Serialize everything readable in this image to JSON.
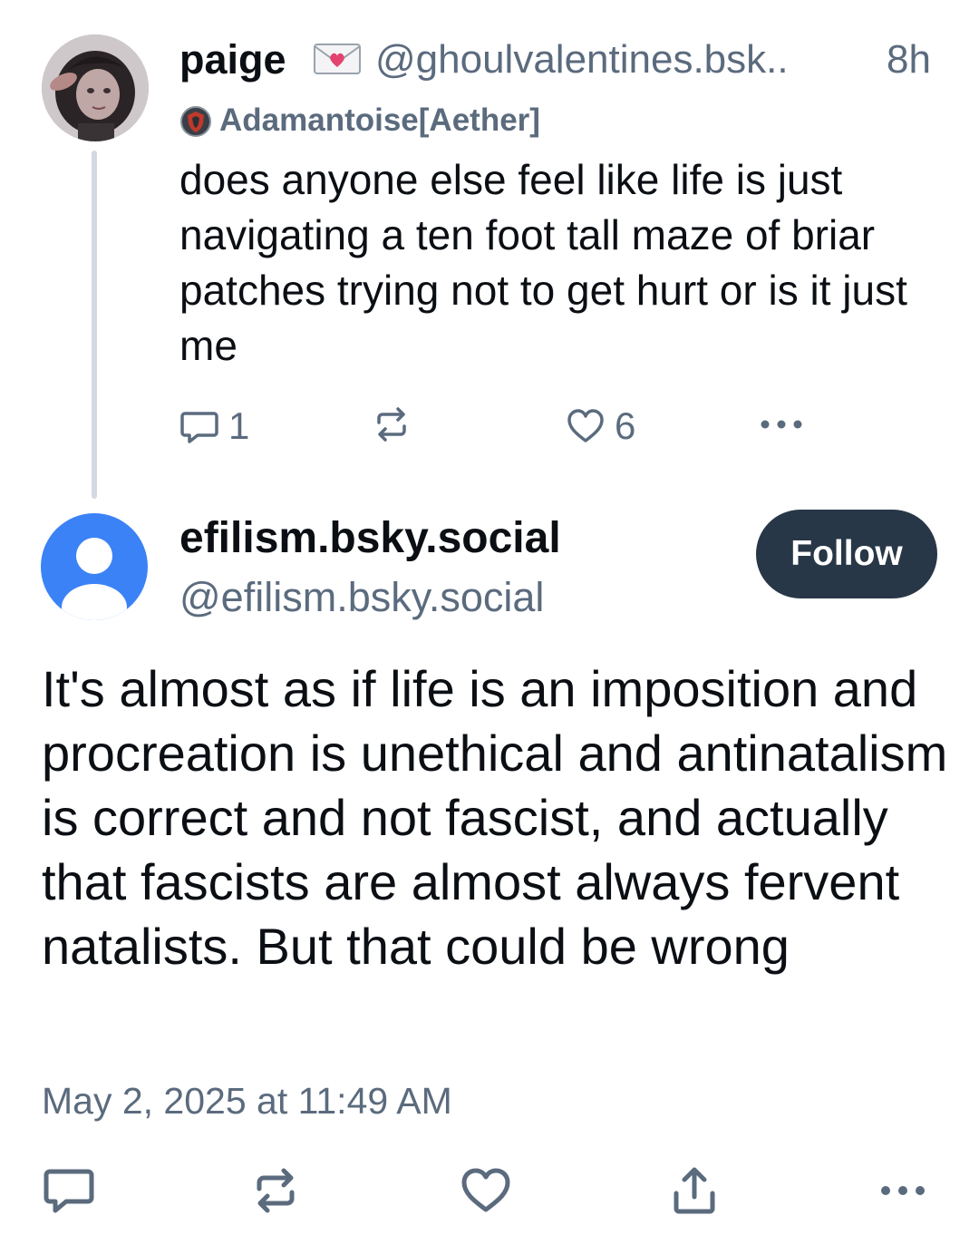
{
  "parent_post": {
    "author_name": "paige",
    "author_emoji_icon": "love-letter-icon",
    "handle": "@ghoulvalentines.bsk..",
    "time_ago": "8h",
    "badge_label": "Adamantoise[Aether]",
    "text": "does anyone else feel like life is just navigating a ten foot tall maze of briar patches trying not to get hurt or is it just me",
    "reply_count": "1",
    "like_count": "6"
  },
  "focus_post": {
    "author_name": "efilism.bsky.social",
    "handle": "@efilism.bsky.social",
    "follow_label": "Follow",
    "text": "It's almost as if life is an imposition and procreation is unethical and antinatalism is correct and not fascist, and actually that fascists are almost always fervent natalists. But that could be wrong",
    "timestamp": "May 2, 2025 at 11:49 AM"
  },
  "colors": {
    "text_primary": "#0b0f14",
    "text_secondary": "#5b6b7e",
    "follow_button_bg": "#283747",
    "default_avatar_blue": "#3b82f6",
    "thread_line": "#d3d9e0"
  }
}
